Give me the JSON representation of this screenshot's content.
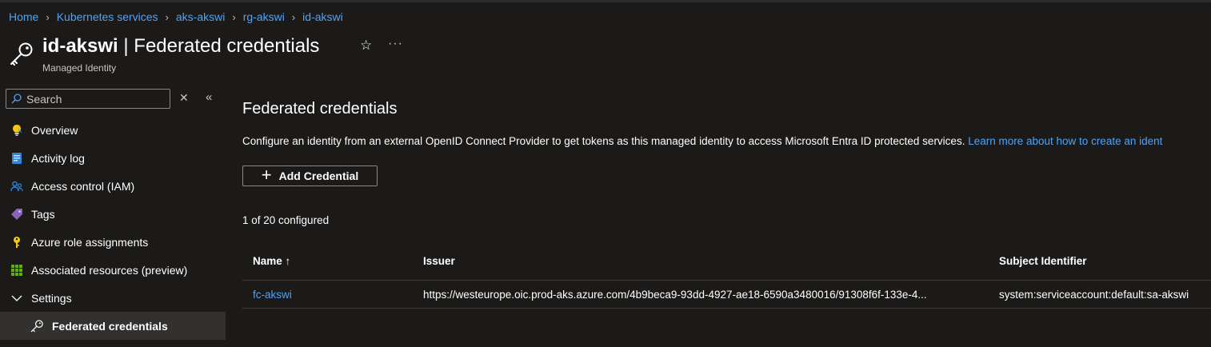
{
  "breadcrumb": [
    {
      "label": "Home"
    },
    {
      "label": "Kubernetes services"
    },
    {
      "label": "aks-akswi"
    },
    {
      "label": "rg-akswi"
    },
    {
      "label": "id-akswi"
    }
  ],
  "header": {
    "resource_name": "id-akswi",
    "separator": "|",
    "page_name": "Federated credentials",
    "subtitle": "Managed Identity",
    "icon": "key-icon",
    "star_icon": "☆",
    "more_icon": "···"
  },
  "sidebar": {
    "search_placeholder": "Search",
    "clear_icon": "✕",
    "collapse_icon": "«",
    "items": [
      {
        "label": "Overview",
        "icon": "lightbulb-icon"
      },
      {
        "label": "Activity log",
        "icon": "activity-log-icon"
      },
      {
        "label": "Access control (IAM)",
        "icon": "people-icon"
      },
      {
        "label": "Tags",
        "icon": "tag-icon"
      },
      {
        "label": "Azure role assignments",
        "icon": "key-icon"
      },
      {
        "label": "Associated resources (preview)",
        "icon": "grid-icon"
      },
      {
        "label": "Settings",
        "icon": "chevron-down-icon"
      },
      {
        "label": "Federated credentials",
        "icon": "key-icon",
        "selected": true
      }
    ]
  },
  "main": {
    "heading": "Federated credentials",
    "description": "Configure an identity from an external OpenID Connect Provider to get tokens as this managed identity to access Microsoft Entra ID protected services.",
    "learn_more": "Learn more about how to create an ident",
    "add_button": "Add Credential",
    "count_text": "1 of 20 configured",
    "table": {
      "columns": [
        "Name ↑",
        "Issuer",
        "Subject Identifier"
      ],
      "rows": [
        {
          "name": "fc-akswi",
          "issuer": "https://westeurope.oic.prod-aks.azure.com/4b9beca9-93dd-4927-ae18-6590a3480016/91308f6f-133e-4...",
          "subject": "system:serviceaccount:default:sa-akswi"
        }
      ]
    }
  },
  "colors": {
    "background": "#1b1a19",
    "link": "#4fa3f5",
    "selected_bg": "#323130"
  }
}
